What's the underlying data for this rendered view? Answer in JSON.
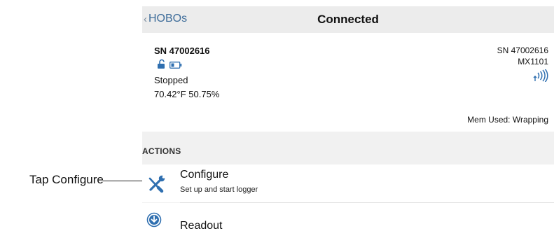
{
  "annotation": {
    "callout_label": "Tap Configure"
  },
  "navbar": {
    "back_label": "HOBOs",
    "title": "Connected"
  },
  "device": {
    "serial_bold": "SN 47002616",
    "status": "Stopped",
    "reading": "70.42°F 50.75%",
    "serial_right": "SN 47002616",
    "model": "MX1101",
    "memory": "Mem Used: Wrapping",
    "icons": [
      "unlock-icon",
      "battery-icon",
      "bluetooth-signal-icon"
    ]
  },
  "actions": {
    "header": "ACTIONS",
    "items": [
      {
        "title": "Configure",
        "subtitle": "Set up and start logger",
        "icon": "wrench-screwdriver-icon"
      },
      {
        "title": "Readout",
        "icon": "download-circle-icon"
      }
    ]
  },
  "colors": {
    "accent": "#3f6d9a",
    "navbar_bg": "#ececec",
    "section_bg": "#f1f1f1"
  }
}
